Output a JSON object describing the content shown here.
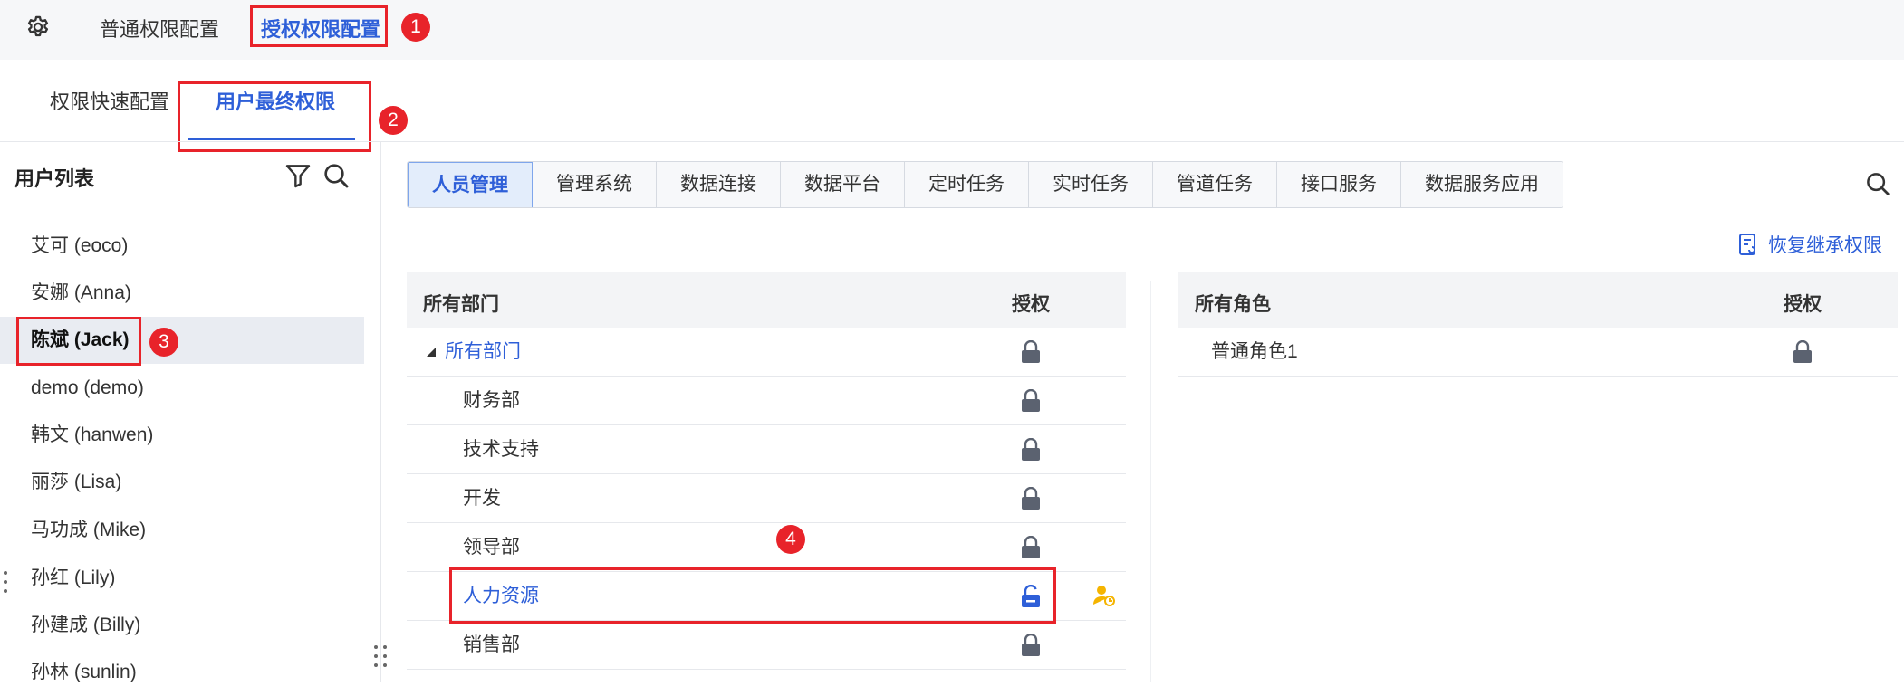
{
  "top_tabs": {
    "normal": "普通权限配置",
    "grant": "授权权限配置"
  },
  "sub_tabs": {
    "quick": "权限快速配置",
    "final": "用户最终权限"
  },
  "user_list": {
    "title": "用户列表",
    "users": [
      {
        "label": "艾可 (eoco)"
      },
      {
        "label": "安娜 (Anna)"
      },
      {
        "label": "陈斌 (Jack)"
      },
      {
        "label": "demo (demo)"
      },
      {
        "label": "韩文 (hanwen)"
      },
      {
        "label": "丽莎 (Lisa)"
      },
      {
        "label": "马功成 (Mike)"
      },
      {
        "label": "孙红 (Lily)"
      },
      {
        "label": "孙建成 (Billy)"
      },
      {
        "label": "孙林 (sunlin)"
      }
    ]
  },
  "module_tabs": [
    "人员管理",
    "管理系统",
    "数据连接",
    "数据平台",
    "定时任务",
    "实时任务",
    "管道任务",
    "接口服务",
    "数据服务应用"
  ],
  "restore_label": "恢复继承权限",
  "dept_table": {
    "col_name": "所有部门",
    "col_auth": "授权",
    "root": "所有部门",
    "rows": [
      "财务部",
      "技术支持",
      "开发",
      "领导部",
      "人力资源",
      "销售部"
    ]
  },
  "role_table": {
    "col_name": "所有角色",
    "col_auth": "授权",
    "rows": [
      "普通角色1"
    ]
  },
  "badges": {
    "b1": "1",
    "b2": "2",
    "b3": "3",
    "b4": "4"
  },
  "colors": {
    "accent": "#2e5fd8",
    "annotation": "#e8232a",
    "lock": "#5b6270",
    "user_icon": "#f5b400"
  }
}
